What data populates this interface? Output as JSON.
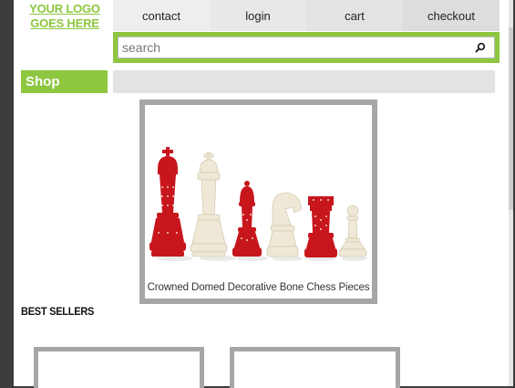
{
  "logo": {
    "text": "YOUR LOGO GOES HERE"
  },
  "nav": {
    "items": [
      "contact",
      "login",
      "cart",
      "checkout"
    ]
  },
  "search": {
    "placeholder": "search"
  },
  "shop": {
    "label": "Shop"
  },
  "banner": {
    "caption": "Crowned Domed Decorative Bone Chess Pieces"
  },
  "sections": {
    "best_sellers": "BEST SELLERS"
  },
  "colors": {
    "accent": "#8dc63f",
    "piece_red": "#c8161d",
    "piece_ivory": "#efe8d6",
    "border_gray": "#a6a6a6"
  },
  "icons": {
    "search": "search-icon"
  }
}
